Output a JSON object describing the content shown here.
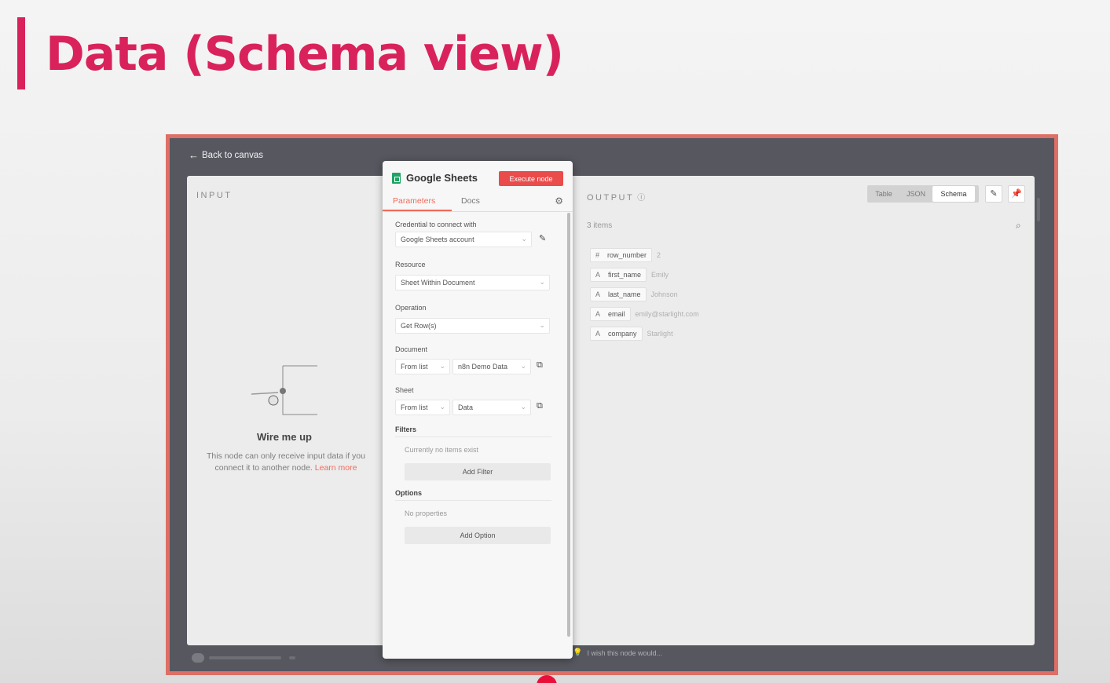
{
  "slide": {
    "title": "Data (Schema view)"
  },
  "app": {
    "back_label": "Back to canvas",
    "input": {
      "label": "INPUT",
      "wire_title": "Wire me up",
      "wire_desc": "This node can only receive input data if you connect it to another node.",
      "learn_more": "Learn more"
    },
    "node": {
      "title": "Google Sheets",
      "execute_label": "Execute node",
      "tabs": [
        "Parameters",
        "Docs"
      ],
      "credential_label": "Credential to connect with",
      "credential_value": "Google Sheets account",
      "resource_label": "Resource",
      "resource_value": "Sheet Within Document",
      "operation_label": "Operation",
      "operation_value": "Get Row(s)",
      "document_label": "Document",
      "document_mode": "From list",
      "document_value": "n8n Demo Data",
      "sheet_label": "Sheet",
      "sheet_mode": "From list",
      "sheet_value": "Data",
      "filters_label": "Filters",
      "filters_empty": "Currently no items exist",
      "add_filter": "Add Filter",
      "options_label": "Options",
      "options_empty": "No properties",
      "add_option": "Add Option"
    },
    "output": {
      "label": "OUTPUT",
      "views": [
        "Table",
        "JSON",
        "Schema"
      ],
      "active_view": "Schema",
      "items_count": "3 items",
      "schema": [
        {
          "type": "#",
          "key": "row_number",
          "value": "2"
        },
        {
          "type": "A",
          "key": "first_name",
          "value": "Emily"
        },
        {
          "type": "A",
          "key": "last_name",
          "value": "Johnson"
        },
        {
          "type": "A",
          "key": "email",
          "value": "emily@starlight.com"
        },
        {
          "type": "A",
          "key": "company",
          "value": "Starlight"
        }
      ],
      "footer_hint": "I wish this node would..."
    }
  },
  "colors": {
    "accent": "#d9225b",
    "execute": "#ea4b4b",
    "tab_active": "#ef6b5c",
    "frame": "#dd6f66"
  }
}
